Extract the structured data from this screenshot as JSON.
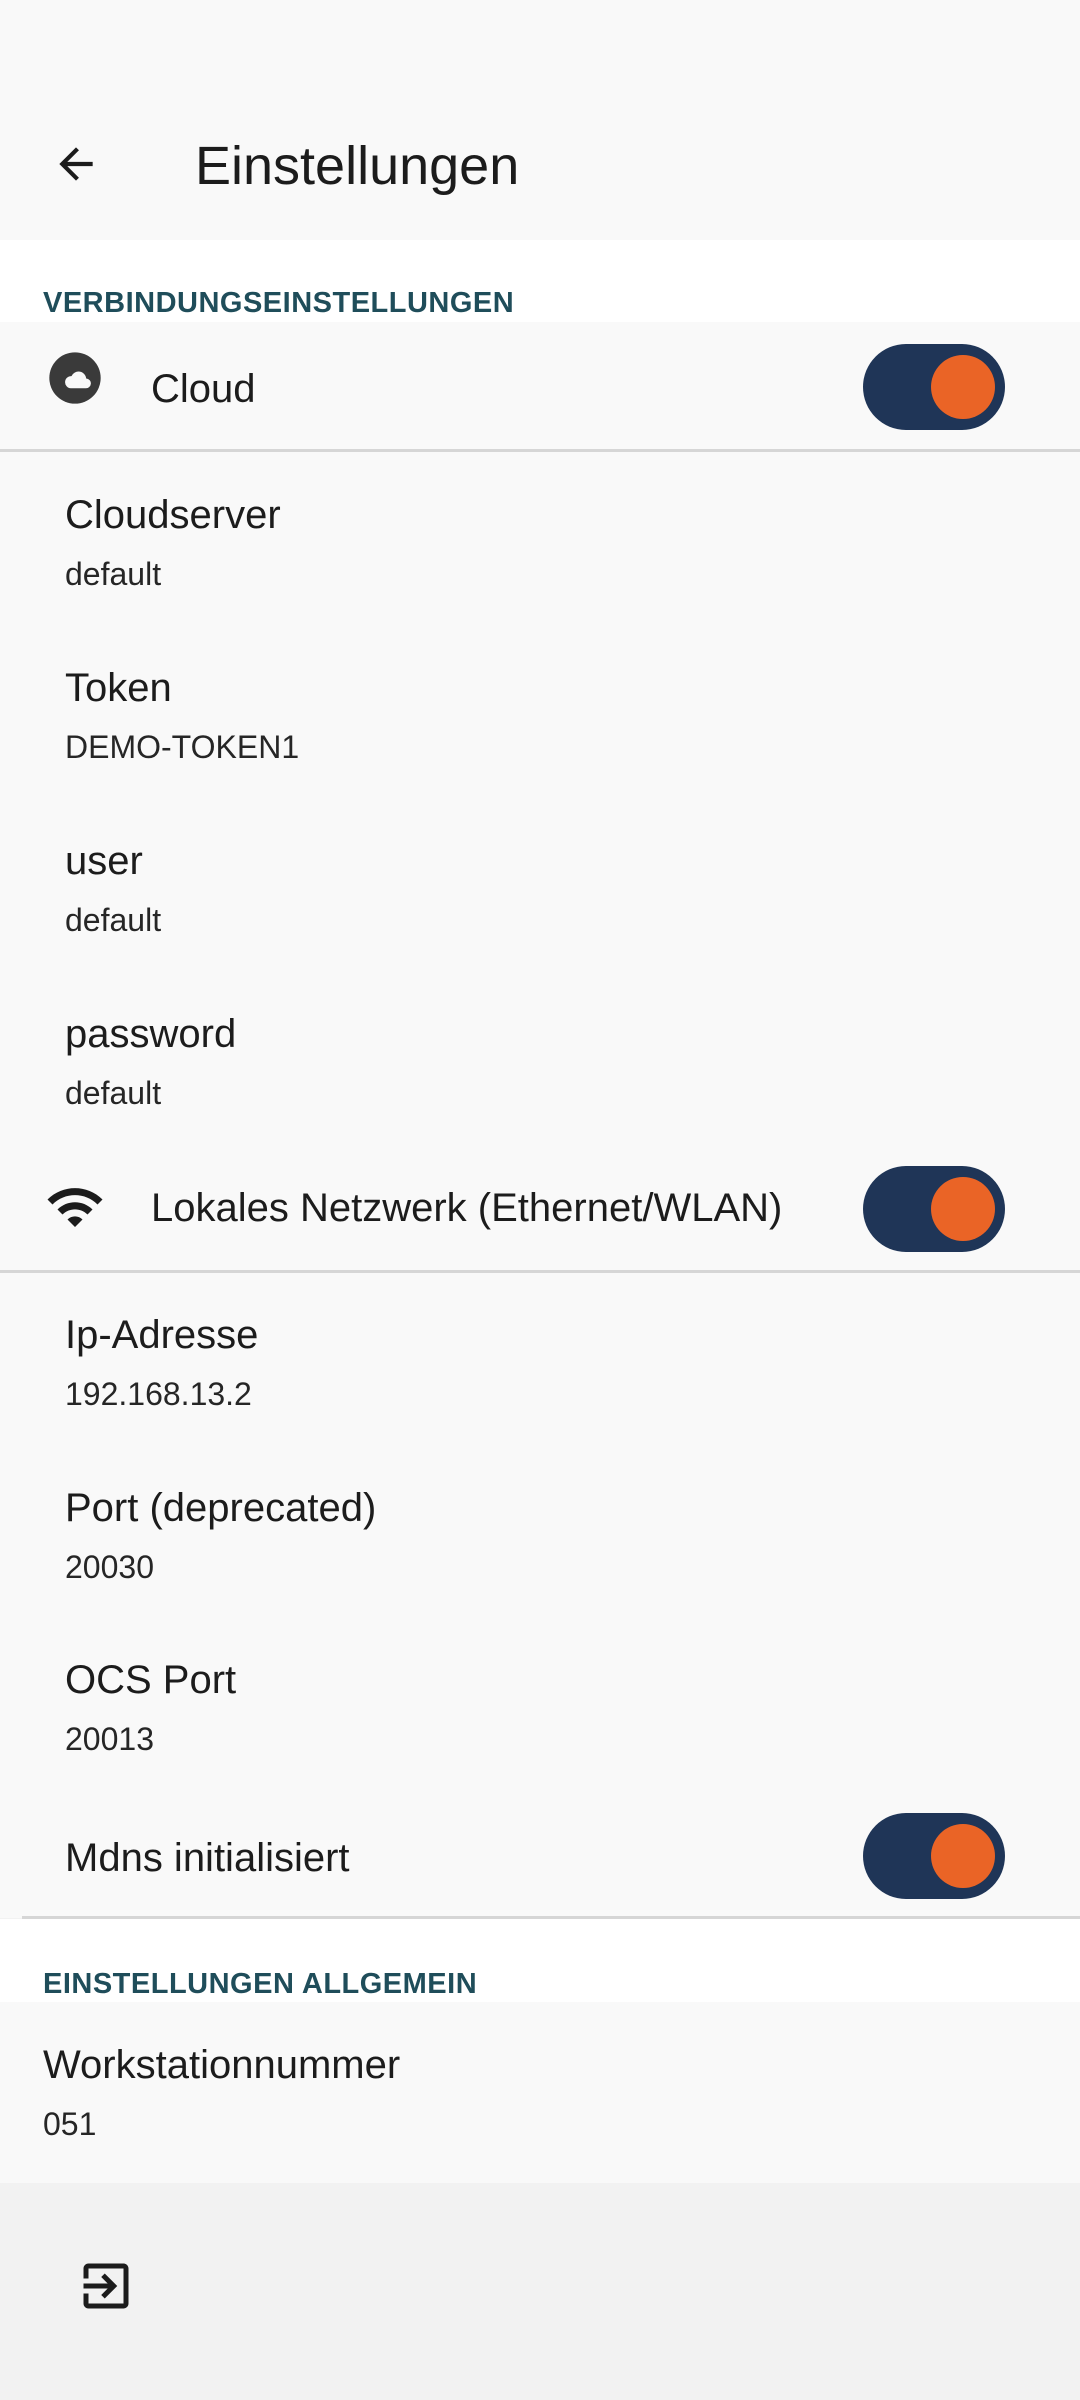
{
  "header": {
    "title": "Einstellungen",
    "back_icon": "arrow-left-icon"
  },
  "connection": {
    "section_title": "VERBINDUNGSEINSTELLUNGEN",
    "cloud": {
      "label": "Cloud",
      "icon": "cloud-icon",
      "enabled": true
    },
    "cloud_items": [
      {
        "title": "Cloudserver",
        "summary": "default"
      },
      {
        "title": "Token",
        "summary": "DEMO-TOKEN1"
      },
      {
        "title": "user",
        "summary": "default"
      },
      {
        "title": "password",
        "summary": "default"
      }
    ],
    "local_network": {
      "label": "Lokales Netzwerk (Ethernet/WLAN)",
      "icon": "wifi-icon",
      "enabled": true
    },
    "network_items": [
      {
        "title": "Ip-Adresse",
        "summary": "192.168.13.2"
      },
      {
        "title": "Port (deprecated)",
        "summary": "20030"
      },
      {
        "title": "OCS Port",
        "summary": "20013"
      }
    ],
    "mdns": {
      "label": "Mdns initialisiert",
      "enabled": true
    }
  },
  "general": {
    "section_title": "EINSTELLUNGEN ALLGEMEIN",
    "workstation": {
      "title": "Workstationnummer",
      "summary": "051"
    }
  },
  "bottom": {
    "exit_icon": "exit-icon"
  },
  "colors": {
    "switch_track": "#1f3557",
    "switch_thumb": "#ea6426",
    "section_header": "#1f4d5a"
  }
}
